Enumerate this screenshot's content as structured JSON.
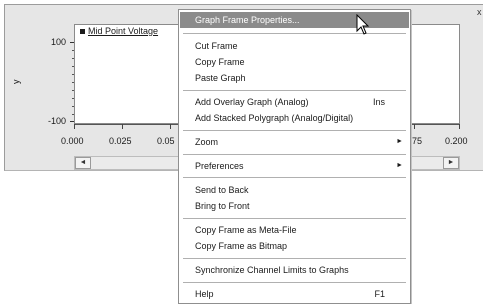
{
  "graph": {
    "close_glyph": "x",
    "legend_label": "Mid Point Voltage",
    "y_axis_label": "y",
    "y_ticks": [
      "100",
      "-100"
    ],
    "x_ticks": [
      "0.000",
      "0.025",
      "0.05",
      "75",
      "0.200"
    ]
  },
  "scrollbar": {
    "left_arrow": "◄",
    "right_arrow": "►"
  },
  "context_menu": {
    "items": [
      {
        "label": "Graph Frame Properties...",
        "shortcut": "",
        "submenu": false
      },
      {
        "label": "Cut Frame",
        "shortcut": "",
        "submenu": false
      },
      {
        "label": "Copy Frame",
        "shortcut": "",
        "submenu": false
      },
      {
        "label": "Paste Graph",
        "shortcut": "",
        "submenu": false
      },
      {
        "label": "Add Overlay Graph (Analog)",
        "shortcut": "Ins",
        "submenu": false
      },
      {
        "label": "Add Stacked Polygraph (Analog/Digital)",
        "shortcut": "",
        "submenu": false
      },
      {
        "label": "Zoom",
        "shortcut": "",
        "submenu": true
      },
      {
        "label": "Preferences",
        "shortcut": "",
        "submenu": true
      },
      {
        "label": "Send to Back",
        "shortcut": "",
        "submenu": false
      },
      {
        "label": "Bring to Front",
        "shortcut": "",
        "submenu": false
      },
      {
        "label": "Copy Frame as Meta-File",
        "shortcut": "",
        "submenu": false
      },
      {
        "label": "Copy Frame as Bitmap",
        "shortcut": "",
        "submenu": false
      },
      {
        "label": "Synchronize Channel Limits to Graphs",
        "shortcut": "",
        "submenu": false
      },
      {
        "label": "Help",
        "shortcut": "F1",
        "submenu": false
      }
    ],
    "submenu_arrow": "►"
  }
}
